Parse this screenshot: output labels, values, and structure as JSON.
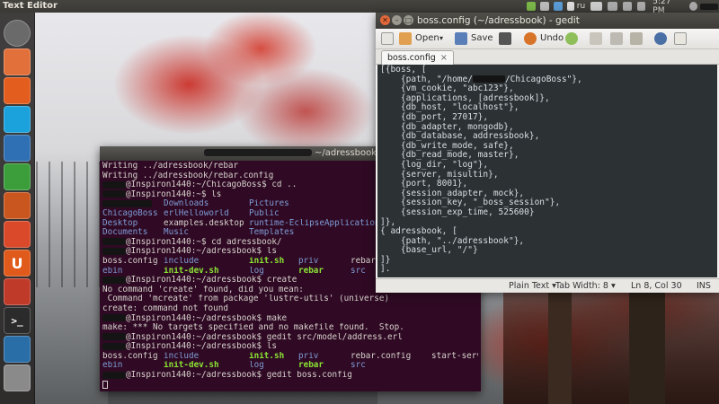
{
  "top_panel": {
    "app_title": "Text Editor",
    "keyboard_layout": "ru",
    "clock": "5:27 PM"
  },
  "launcher": {
    "items": [
      {
        "name": "dash-home",
        "color": "#6a6a6a"
      },
      {
        "name": "files",
        "color": "#e2703a"
      },
      {
        "name": "firefox",
        "color": "#e35d1e"
      },
      {
        "name": "skype",
        "color": "#1ba2dc"
      },
      {
        "name": "libreoffice-writer",
        "color": "#2f6fb4"
      },
      {
        "name": "libreoffice-calc",
        "color": "#3b9e3b"
      },
      {
        "name": "libreoffice-impress",
        "color": "#c8561e"
      },
      {
        "name": "software-center",
        "color": "#d9492a"
      },
      {
        "name": "ubuntu-one",
        "color": "#e05a1c"
      },
      {
        "name": "system-settings",
        "color": "#c03a2a"
      },
      {
        "name": "terminal",
        "color": "#2b2b2b"
      },
      {
        "name": "update-manager",
        "color": "#2a6ea8"
      },
      {
        "name": "trash",
        "color": "#8a8a8a"
      }
    ],
    "terminal_glyph": ">_",
    "ubuntu_one_glyph": "U"
  },
  "terminal": {
    "title": "~/adressbook",
    "lines": [
      {
        "text": "Writing ../adressbook/rebar"
      },
      {
        "text": "Writing ../adressbook/rebar.config"
      },
      {
        "prompt": "@Inspiron1440:~/ChicagoBoss$ ",
        "cmd": "cd .."
      },
      {
        "prompt": "@Inspiron1440:~$ ",
        "cmd": "ls"
      },
      {
        "cols": [
          [
            "",
            ""
          ],
          [
            "Downloads",
            "blue"
          ],
          [
            "Pictures",
            "blue"
          ]
        ]
      },
      {
        "cols": [
          [
            "ChicagoBoss",
            "blue"
          ],
          [
            "erlHelloworld",
            "blue"
          ],
          [
            "Public",
            "blue"
          ]
        ]
      },
      {
        "cols": [
          [
            "Desktop",
            "blue"
          ],
          [
            "examples.desktop",
            ""
          ],
          [
            "runtime-EclipseApplication",
            "blue"
          ]
        ]
      },
      {
        "cols": [
          [
            "Documents",
            "blue"
          ],
          [
            "Music",
            "blue"
          ],
          [
            "Templates",
            "blue"
          ]
        ]
      },
      {
        "prompt": "@Inspiron1440:~$ ",
        "cmd": "cd adressbook/"
      },
      {
        "prompt": "@Inspiron1440:~/adressbook$ ",
        "cmd": "ls"
      },
      {
        "cols": [
          [
            "boss.config",
            ""
          ],
          [
            "include",
            "blue"
          ],
          [
            "init.sh",
            "green"
          ],
          [
            "priv",
            "blue"
          ],
          [
            "rebar.config",
            ""
          ],
          [
            "st",
            ""
          ]
        ]
      },
      {
        "cols": [
          [
            "ebin",
            "blue"
          ],
          [
            "init-dev.sh",
            "green"
          ],
          [
            "log",
            "blue"
          ],
          [
            "rebar",
            "green"
          ],
          [
            "src",
            "blue"
          ]
        ]
      },
      {
        "prompt": "@Inspiron1440:~/adressbook$ ",
        "cmd": "create"
      },
      {
        "text": "No command 'create' found, did you mean:"
      },
      {
        "text": " Command 'mcreate' from package 'lustre-utils' (universe)"
      },
      {
        "text": "create: command not found"
      },
      {
        "prompt": "@Inspiron1440:~/adressbook$ ",
        "cmd": "make"
      },
      {
        "text": "make: *** No targets specified and no makefile found.  Stop."
      },
      {
        "prompt": "@Inspiron1440:~/adressbook$ ",
        "cmd": "gedit src/model/address.erl"
      },
      {
        "prompt": "@Inspiron1440:~/adressbook$ ",
        "cmd": "ls"
      },
      {
        "cols": [
          [
            "boss.config",
            ""
          ],
          [
            "include",
            "blue"
          ],
          [
            "init.sh",
            "green"
          ],
          [
            "priv",
            "blue"
          ],
          [
            "rebar.config",
            ""
          ],
          [
            "start-server.bat",
            ""
          ]
        ]
      },
      {
        "cols": [
          [
            "ebin",
            "blue"
          ],
          [
            "init-dev.sh",
            "green"
          ],
          [
            "log",
            "blue"
          ],
          [
            "rebar",
            "green"
          ],
          [
            "src",
            "blue"
          ]
        ]
      },
      {
        "prompt": "@Inspiron1440:~/adressbook$ ",
        "cmd": "gedit boss.config"
      },
      {
        "cursor": true
      }
    ]
  },
  "gedit": {
    "title": "boss.config (~/adressbook) - gedit",
    "toolbar": {
      "open_label": "Open",
      "save_label": "Save",
      "undo_label": "Undo"
    },
    "tab_label": "boss.config",
    "tab_close": "×",
    "editor_lines": [
      "[{boss, [",
      "    {path, \"/home/",
      "    {vm_cookie, \"abc123\"},",
      "    {applications, [adressbook]},",
      "    {db_host, \"localhost\"},",
      "    {db_port, 27017},",
      "    {db_adapter, mongodb},",
      "    {db_database, addressbook},",
      "    {db_write_mode, safe},",
      "    {db_read_mode, master},",
      "    {log_dir, \"log\"},",
      "    {server, misultin},",
      "    {port, 8001},",
      "    {session_adapter, mock},",
      "    {session_key, \"_boss_session\"},",
      "    {session_exp_time, 525600}",
      "]},",
      "{ adressbook, [",
      "    {path, \"../adressbook\"},",
      "    {base_url, \"/\"}",
      "]}",
      "]."
    ],
    "path_suffix": "/ChicagoBoss\"},",
    "status": {
      "language": "Plain Text",
      "tab_width": "Tab Width: 8",
      "position": "Ln 8, Col 30",
      "mode": "INS"
    }
  }
}
